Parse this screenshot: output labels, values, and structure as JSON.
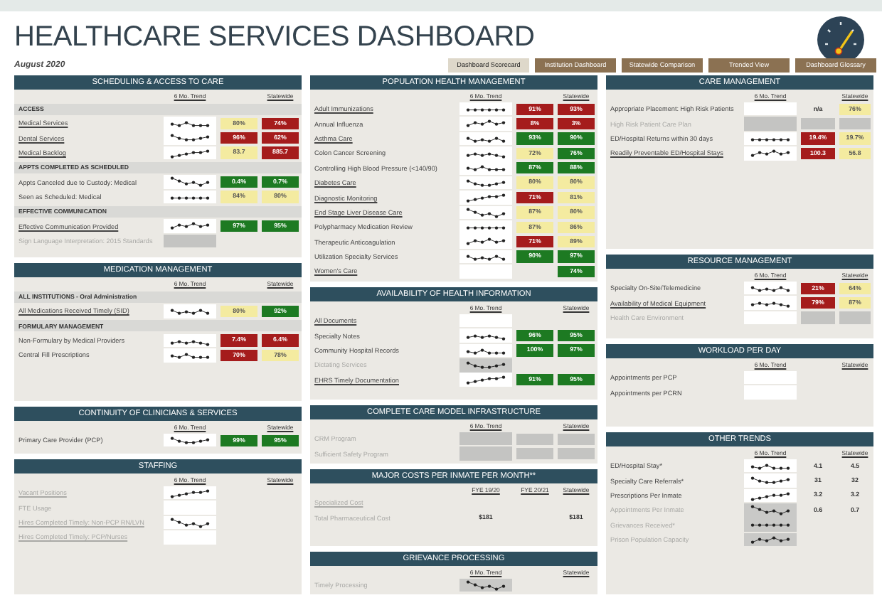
{
  "title": "HEALTHCARE SERVICES DASHBOARD",
  "date": "August 2020",
  "tabs": [
    {
      "label": "Dashboard Scorecard",
      "selected": true
    },
    {
      "label": "Institution Dashboard",
      "selected": false
    },
    {
      "label": "Statewide Comparison",
      "selected": false
    },
    {
      "label": "Trended View",
      "selected": false
    },
    {
      "label": "Dashboard Glossary",
      "selected": false
    }
  ],
  "columns": [
    [
      {
        "title": "SCHEDULING & ACCESS TO CARE",
        "head": {
          "col_1": "6 Mo. Trend",
          "col_3": "Statewide"
        },
        "rows": [
          {
            "kind": "group",
            "label": "ACCESS"
          },
          {
            "kind": "link",
            "label": "Medical Services",
            "disabled": false,
            "trend": {
              "kind": "line"
            },
            "col_2": {
              "text": "80%",
              "color": "#f4eba0"
            },
            "col_3": {
              "text": "74%",
              "color": "#a51c1c"
            }
          },
          {
            "kind": "link",
            "label": "Dental Services",
            "disabled": false,
            "trend": {
              "kind": "line"
            },
            "col_2": {
              "text": "96%",
              "color": "#a51c1c"
            },
            "col_3": {
              "text": "62%",
              "color": "#a51c1c"
            }
          },
          {
            "kind": "link",
            "label": "Medical Backlog",
            "disabled": false,
            "trend": {
              "kind": "line"
            },
            "col_2": {
              "text": "83.7",
              "color": "#f4eba0"
            },
            "col_3": {
              "text": "885.7",
              "color": "#a51c1c"
            }
          },
          {
            "kind": "group",
            "label": "APPTS COMPLETED AS SCHEDULED"
          },
          {
            "kind": "metric",
            "label": "Appts Canceled due to Custody: Medical",
            "disabled": false,
            "trend": {
              "kind": "line"
            },
            "col_2": {
              "text": "0.4%",
              "color": "#1d7a22"
            },
            "col_3": {
              "text": "0.7%",
              "color": "#1d7a22"
            }
          },
          {
            "kind": "metric",
            "label": "Seen as Scheduled: Medical",
            "disabled": false,
            "trend": {
              "kind": "line"
            },
            "col_2": {
              "text": "84%",
              "color": "#f4eba0"
            },
            "col_3": {
              "text": "80%",
              "color": "#f4eba0"
            }
          },
          {
            "kind": "group",
            "label": "EFFECTIVE COMMUNICATION"
          },
          {
            "kind": "link",
            "label": "Effective Communication Provided",
            "disabled": false,
            "trend": {
              "kind": "line"
            },
            "col_2": {
              "text": "97%",
              "color": "#1d7a22"
            },
            "col_3": {
              "text": "95%",
              "color": "#1d7a22"
            }
          },
          {
            "kind": "metric",
            "label": "Sign Language Interpretation: 2015 Standards",
            "disabled": true,
            "trend": {
              "kind": "grey"
            }
          }
        ]
      },
      {
        "title": "MEDICATION MANAGEMENT",
        "head": {
          "col_1": "6 Mo. Trend",
          "col_3": "Statewide"
        },
        "rows": [
          {
            "kind": "group",
            "label": "ALL INSTITUTIONS - Oral Administration"
          },
          {
            "kind": "link",
            "label": "All Medications Received Timely (SID)",
            "disabled": false,
            "trend": {
              "kind": "line"
            },
            "col_2": {
              "text": "80%",
              "color": "#f4eba0"
            },
            "col_3": {
              "text": "92%",
              "color": "#1d7a22"
            }
          },
          {
            "kind": "group",
            "label": "FORMULARY MANAGEMENT"
          },
          {
            "kind": "metric",
            "label": "Non-Formulary by Medical Providers",
            "disabled": false,
            "trend": {
              "kind": "line"
            },
            "col_2": {
              "text": "7.4%",
              "color": "#a51c1c"
            },
            "col_3": {
              "text": "6.4%",
              "color": "#a51c1c"
            }
          },
          {
            "kind": "metric",
            "label": "Central Fill Prescriptions",
            "disabled": false,
            "trend": {
              "kind": "line"
            },
            "col_2": {
              "text": "70%",
              "color": "#a51c1c"
            },
            "col_3": {
              "text": "78%",
              "color": "#f4eba0"
            }
          }
        ]
      },
      {
        "title": "CONTINUITY OF CLINICIANS & SERVICES",
        "head": {
          "col_1": "6 Mo. Trend",
          "col_3": "Statewide"
        },
        "rows": [
          {
            "kind": "metric",
            "label": "Primary Care Provider (PCP)",
            "disabled": false,
            "trend": {
              "kind": "line"
            },
            "col_2": {
              "text": "99%",
              "color": "#1d7a22"
            },
            "col_3": {
              "text": "95%",
              "color": "#1d7a22"
            }
          }
        ]
      },
      {
        "title": "STAFFING",
        "head": {
          "col_1": "6 Mo. Trend",
          "col_3": "Statewide"
        },
        "rows": [
          {
            "kind": "link",
            "label": "Vacant Positions",
            "disabled": true,
            "trend": {
              "kind": "line"
            }
          },
          {
            "kind": "metric",
            "label": "FTE Usage",
            "disabled": true,
            "trend": {
              "kind": "blank"
            }
          },
          {
            "kind": "link",
            "label": "Hires Completed Timely: Non-PCP RN/LVN",
            "disabled": true,
            "trend": {
              "kind": "line"
            }
          },
          {
            "kind": "link",
            "label": "Hires Completed Timely: PCP/Nurses",
            "disabled": true,
            "trend": {
              "kind": "blank"
            }
          }
        ]
      }
    ],
    [
      {
        "title": "POPULATION HEALTH MANAGEMENT",
        "head": {
          "col_1": "6 Mo. Trend",
          "col_3": "Statewide"
        },
        "rows": [
          {
            "kind": "link",
            "label": "Adult Immunizations",
            "disabled": false,
            "trend": {
              "kind": "line"
            },
            "col_2": {
              "text": "91%",
              "color": "#a51c1c"
            },
            "col_3": {
              "text": "93%",
              "color": "#a51c1c"
            }
          },
          {
            "kind": "metric",
            "label": "Annual Influenza",
            "disabled": false,
            "trend": {
              "kind": "line"
            },
            "col_2": {
              "text": "8%",
              "color": "#a51c1c"
            },
            "col_3": {
              "text": "3%",
              "color": "#a51c1c"
            }
          },
          {
            "kind": "link",
            "label": "Asthma Care",
            "disabled": false,
            "trend": {
              "kind": "line"
            },
            "col_2": {
              "text": "93%",
              "color": "#1d7a22"
            },
            "col_3": {
              "text": "90%",
              "color": "#1d7a22"
            }
          },
          {
            "kind": "metric",
            "label": "Colon Cancer Screening",
            "disabled": false,
            "trend": {
              "kind": "line"
            },
            "col_2": {
              "text": "72%",
              "color": "#f4eba0"
            },
            "col_3": {
              "text": "76%",
              "color": "#1d7a22"
            }
          },
          {
            "kind": "metric",
            "label": "Controlling High Blood Pressure (<140/90)",
            "disabled": false,
            "trend": {
              "kind": "line"
            },
            "col_2": {
              "text": "87%",
              "color": "#1d7a22"
            },
            "col_3": {
              "text": "88%",
              "color": "#1d7a22"
            }
          },
          {
            "kind": "link",
            "label": "Diabetes Care",
            "disabled": false,
            "trend": {
              "kind": "line"
            },
            "col_2": {
              "text": "80%",
              "color": "#f4eba0"
            },
            "col_3": {
              "text": "80%",
              "color": "#f4eba0"
            }
          },
          {
            "kind": "link",
            "label": "Diagnostic Monitoring",
            "disabled": false,
            "trend": {
              "kind": "line"
            },
            "col_2": {
              "text": "71%",
              "color": "#a51c1c"
            },
            "col_3": {
              "text": "81%",
              "color": "#f4eba0"
            }
          },
          {
            "kind": "link",
            "label": "End Stage Liver Disease Care",
            "disabled": false,
            "trend": {
              "kind": "line"
            },
            "col_2": {
              "text": "87%",
              "color": "#f4eba0"
            },
            "col_3": {
              "text": "80%",
              "color": "#f4eba0"
            }
          },
          {
            "kind": "metric",
            "label": "Polypharmacy Medication Review",
            "disabled": false,
            "trend": {
              "kind": "line"
            },
            "col_2": {
              "text": "87%",
              "color": "#f4eba0"
            },
            "col_3": {
              "text": "86%",
              "color": "#f4eba0"
            }
          },
          {
            "kind": "metric",
            "label": "Therapeutic Anticoagulation",
            "disabled": false,
            "trend": {
              "kind": "line"
            },
            "col_2": {
              "text": "71%",
              "color": "#a51c1c"
            },
            "col_3": {
              "text": "89%",
              "color": "#f4eba0"
            }
          },
          {
            "kind": "metric",
            "label": "Utilization Specialty Services",
            "disabled": false,
            "trend": {
              "kind": "line"
            },
            "col_2": {
              "text": "90%",
              "color": "#1d7a22"
            },
            "col_3": {
              "text": "97%",
              "color": "#1d7a22"
            }
          },
          {
            "kind": "link",
            "label": "Women's Care",
            "disabled": false,
            "trend": {
              "kind": "blank"
            },
            "col_3": {
              "text": "74%",
              "color": "#1d7a22"
            }
          }
        ]
      },
      {
        "title": "AVAILABILITY OF HEALTH INFORMATION",
        "head": {
          "col_1": "6 Mo. Trend",
          "col_3": "Statewide"
        },
        "rows": [
          {
            "kind": "link",
            "label": "All Documents",
            "disabled": false,
            "trend": {
              "kind": "blank"
            }
          },
          {
            "kind": "metric",
            "label": "Specialty Notes",
            "disabled": false,
            "trend": {
              "kind": "line"
            },
            "col_2": {
              "text": "96%",
              "color": "#1d7a22"
            },
            "col_3": {
              "text": "95%",
              "color": "#1d7a22"
            }
          },
          {
            "kind": "metric",
            "label": "Community Hospital Records",
            "disabled": false,
            "trend": {
              "kind": "line"
            },
            "col_2": {
              "text": "100%",
              "color": "#1d7a22"
            },
            "col_3": {
              "text": "97%",
              "color": "#1d7a22"
            }
          },
          {
            "kind": "metric",
            "label": "Dictating Services",
            "disabled": true,
            "trend": {
              "kind": "shaded"
            }
          },
          {
            "kind": "link",
            "label": "EHRS Timely Documentation",
            "disabled": false,
            "trend": {
              "kind": "line"
            },
            "col_2": {
              "text": "91%",
              "color": "#1d7a22"
            },
            "col_3": {
              "text": "95%",
              "color": "#1d7a22"
            }
          }
        ]
      },
      {
        "title": "COMPLETE CARE MODEL INFRASTRUCTURE",
        "head": {
          "col_1": "6 Mo. Trend",
          "col_3": "Statewide"
        },
        "rows": [
          {
            "kind": "metric",
            "label": "CRM Program",
            "disabled": true,
            "trend": {
              "kind": "grey"
            },
            "col_2": {
              "color": "#c4c4c2"
            },
            "col_3": {
              "color": "#c4c4c2"
            }
          },
          {
            "kind": "metric",
            "label": "Sufficient Safety Program",
            "disabled": true,
            "trend": {
              "kind": "grey"
            },
            "col_2": {
              "color": "#c4c4c2"
            },
            "col_3": {
              "color": "#c4c4c2"
            }
          }
        ]
      },
      {
        "title": "MAJOR COSTS PER INMATE PER MONTH**",
        "head": {
          "col_1": "FYE 19/20",
          "col_2": "FYE 20/21",
          "col_3": "Statewide"
        },
        "rows": [
          {
            "kind": "link",
            "label": "Specialized Cost",
            "disabled": true
          },
          {
            "kind": "metric",
            "label": "Total Pharmaceutical Cost",
            "disabled": true,
            "col_1": {
              "text": "$181"
            },
            "col_3": {
              "text": "$181"
            }
          }
        ]
      },
      {
        "title": "GRIEVANCE PROCESSING",
        "head": {
          "col_1": "6 Mo. Trend",
          "col_3": "Statewide"
        },
        "rows": [
          {
            "kind": "metric",
            "label": "Timely Processing",
            "disabled": true,
            "trend": {
              "kind": "shaded"
            }
          }
        ]
      }
    ],
    [
      {
        "title": "CARE MANAGEMENT",
        "head": {
          "col_1": "6 Mo. Trend",
          "col_3": "Statewide"
        },
        "rows": [
          {
            "kind": "metric",
            "label": "Appropriate Placement: High Risk Patients",
            "disabled": false,
            "trend": {
              "kind": "blank"
            },
            "col_2": {
              "text": "n/a"
            },
            "col_3": {
              "text": "76%",
              "color": "#f4eba0"
            }
          },
          {
            "kind": "metric",
            "label": "High Risk Patient Care Plan",
            "disabled": true,
            "trend": {
              "kind": "grey"
            },
            "col_2": {
              "color": "#c4c4c2"
            },
            "col_3": {
              "color": "#c4c4c2"
            }
          },
          {
            "kind": "metric",
            "label": "ED/Hospital Returns within 30 days",
            "disabled": false,
            "trend": {
              "kind": "line"
            },
            "col_2": {
              "text": "19.4%",
              "color": "#a51c1c"
            },
            "col_3": {
              "text": "19.7%",
              "color": "#f4eba0"
            }
          },
          {
            "kind": "link",
            "label": "Readily Preventable ED/Hospital Stays",
            "disabled": false,
            "trend": {
              "kind": "line"
            },
            "col_2": {
              "text": "100.3",
              "color": "#a51c1c"
            },
            "col_3": {
              "text": "56.8",
              "color": "#f4eba0"
            }
          }
        ]
      },
      {
        "title": "RESOURCE MANAGEMENT",
        "head": {
          "col_1": "6 Mo. Trend",
          "col_3": "Statewide"
        },
        "rows": [
          {
            "kind": "metric",
            "label": "Specialty On-Site/Telemedicine",
            "disabled": false,
            "trend": {
              "kind": "line"
            },
            "col_2": {
              "text": "21%",
              "color": "#a51c1c"
            },
            "col_3": {
              "text": "64%",
              "color": "#f4eba0"
            }
          },
          {
            "kind": "link",
            "label": "Availability of Medical Equipment",
            "disabled": false,
            "trend": {
              "kind": "line"
            },
            "col_2": {
              "text": "79%",
              "color": "#a51c1c"
            },
            "col_3": {
              "text": "87%",
              "color": "#f4eba0"
            }
          },
          {
            "kind": "metric",
            "label": "Health Care Environment",
            "disabled": true,
            "trend": {
              "kind": "blank"
            },
            "col_2": {
              "color": "#c4c4c2"
            },
            "col_3": {
              "color": "#c4c4c2"
            }
          }
        ]
      },
      {
        "title": "WORKLOAD PER DAY",
        "head": {
          "col_1": "6 Mo. Trend",
          "col_3": "Statewide"
        },
        "rows": [
          {
            "kind": "metric",
            "label": "Appointments per PCP",
            "disabled": false,
            "trend": {
              "kind": "blank"
            }
          },
          {
            "kind": "metric",
            "label": "Appointments per PCRN",
            "disabled": false,
            "trend": {
              "kind": "blank"
            }
          }
        ]
      },
      {
        "title": "OTHER TRENDS",
        "head": {
          "col_1": "6 Mo. Trend",
          "col_3": "Statewide"
        },
        "rows": [
          {
            "kind": "metric",
            "label": "ED/Hospital Stay*",
            "disabled": false,
            "trend": {
              "kind": "line"
            },
            "col_2": {
              "text": "4.1"
            },
            "col_3": {
              "text": "4.5"
            }
          },
          {
            "kind": "metric",
            "label": "Specialty Care Referrals*",
            "disabled": false,
            "trend": {
              "kind": "line"
            },
            "col_2": {
              "text": "31"
            },
            "col_3": {
              "text": "32"
            }
          },
          {
            "kind": "metric",
            "label": "Prescriptions Per Inmate",
            "disabled": false,
            "trend": {
              "kind": "line"
            },
            "col_2": {
              "text": "3.2"
            },
            "col_3": {
              "text": "3.2"
            }
          },
          {
            "kind": "metric",
            "label": "Appointments Per Inmate",
            "disabled": true,
            "trend": {
              "kind": "shaded"
            },
            "col_2": {
              "text": "0.6"
            },
            "col_3": {
              "text": "0.7"
            }
          },
          {
            "kind": "metric",
            "label": "Grievances Received*",
            "disabled": true,
            "trend": {
              "kind": "shaded"
            }
          },
          {
            "kind": "metric",
            "label": "Prison Population Capacity",
            "disabled": true,
            "trend": {
              "kind": "shaded"
            }
          }
        ]
      }
    ]
  ]
}
